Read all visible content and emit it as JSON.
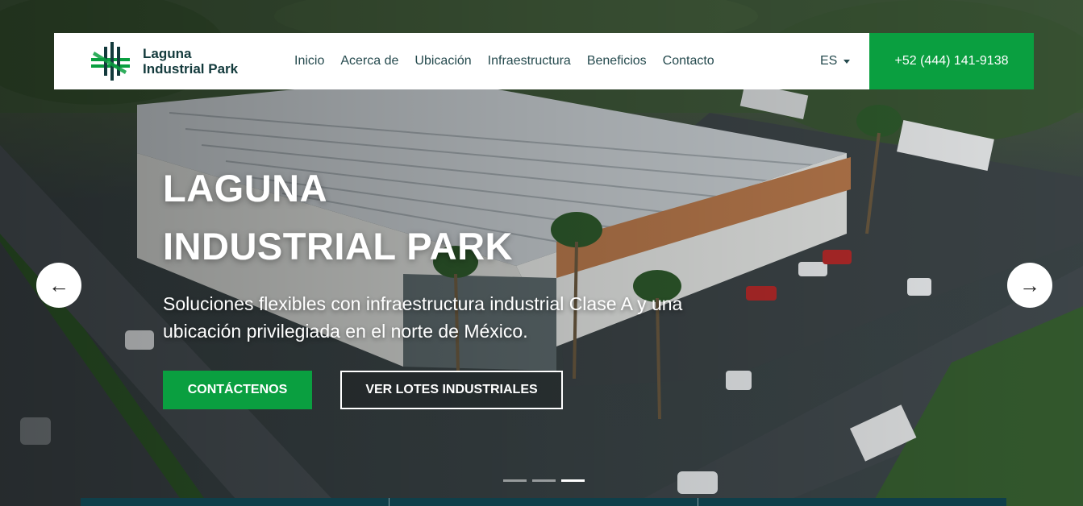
{
  "brand": {
    "name_line1": "Laguna",
    "name_line2": "Industrial Park",
    "logo_icon": "lip-logo-icon"
  },
  "nav": {
    "links": [
      {
        "label": "Inicio"
      },
      {
        "label": "Acerca de"
      },
      {
        "label": "Ubicación"
      },
      {
        "label": "Infraestructura"
      },
      {
        "label": "Beneficios"
      },
      {
        "label": "Contacto"
      }
    ],
    "language": "ES",
    "phone": "+52 (444) 141-9138"
  },
  "hero": {
    "title_line1": "LAGUNA",
    "title_line2": "INDUSTRIAL PARK",
    "subtitle": "Soluciones flexibles con infraestructura industrial Clase A y una ubicación privilegiada en el norte de México.",
    "primary_button": "CONTÁCTENOS",
    "secondary_button": "VER LOTES INDUSTRIALES",
    "prev_arrow": "←",
    "next_arrow": "→"
  },
  "carousel": {
    "slide_count": 3,
    "active_slide": 3
  },
  "colors": {
    "accent_green": "#0a9f40",
    "brand_dark": "#133a3c",
    "nav_text": "#254a4e",
    "bottom_bar": "#0f3f4a"
  }
}
